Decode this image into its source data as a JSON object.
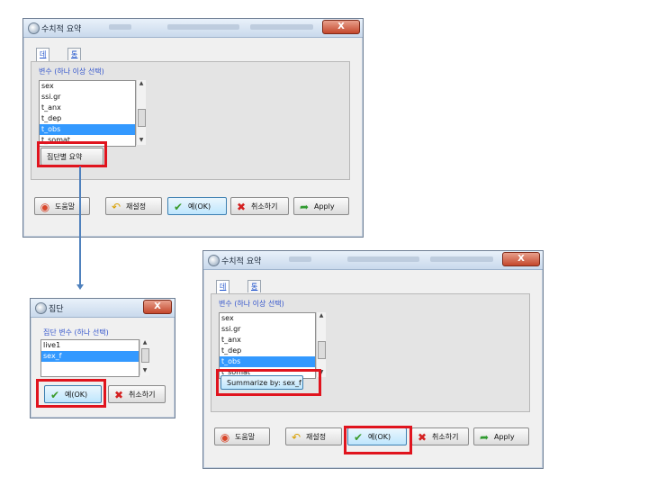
{
  "window1": {
    "title": "수치적 요약",
    "close": "X",
    "tabs": [
      "데이터",
      "통계"
    ],
    "group_label": "변수 (하나 이상 선택)",
    "variables": [
      "sex",
      "ssi.gr",
      "t_anx",
      "t_dep",
      "t_obs",
      "t_somat"
    ],
    "selected_variable": "t_obs",
    "summarize_button": "집단별 요약",
    "buttons": {
      "help": "도움말",
      "reset": "재설정",
      "ok": "예(OK)",
      "cancel": "취소하기",
      "apply": "Apply"
    }
  },
  "window2": {
    "title": "집단",
    "close": "X",
    "group_label": "집단 변수 (하나 선택)",
    "variables": [
      "live1",
      "sex_f"
    ],
    "selected_variable": "sex_f",
    "buttons": {
      "ok": "예(OK)",
      "cancel": "취소하기"
    }
  },
  "window3": {
    "title": "수치적 요약",
    "close": "X",
    "tabs": [
      "데이터",
      "통계"
    ],
    "group_label": "변수 (하나 이상 선택)",
    "variables": [
      "sex",
      "ssi.gr",
      "t_anx",
      "t_dep",
      "t_obs",
      "t_somat"
    ],
    "selected_variable": "t_obs",
    "summarize_button": "Summarize by: sex_f",
    "buttons": {
      "help": "도움말",
      "reset": "재설정",
      "ok": "예(OK)",
      "cancel": "취소하기",
      "apply": "Apply"
    }
  },
  "colors": {
    "highlight": "#e0141e",
    "connector": "#4f81bd",
    "selection": "#3399ff"
  },
  "icons": {
    "help": "lifebuoy-icon",
    "reset": "undo-arrow-icon",
    "ok": "checkmark-icon",
    "cancel": "x-cross-icon",
    "apply": "apply-arrow-icon"
  }
}
